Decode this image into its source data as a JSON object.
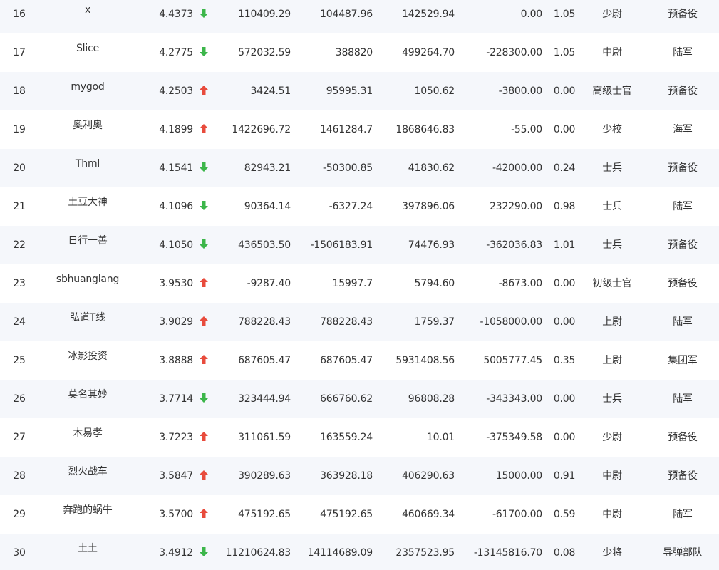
{
  "colors": {
    "up_arrow": "#e84b3c",
    "down_arrow": "#3cb64a",
    "text": "#333333",
    "row_stripe": "#f5f7fb"
  },
  "rows": [
    {
      "rank": "16",
      "name": "x",
      "score": "4.4373",
      "trend": "down",
      "v1": "110409.29",
      "v2": "104487.96",
      "v3": "142529.94",
      "v4": "0.00",
      "ratio": "1.05",
      "title": "少尉",
      "army": "预备役"
    },
    {
      "rank": "17",
      "name": "Slice",
      "score": "4.2775",
      "trend": "down",
      "v1": "572032.59",
      "v2": "388820",
      "v3": "499264.70",
      "v4": "-228300.00",
      "ratio": "1.05",
      "title": "中尉",
      "army": "陆军"
    },
    {
      "rank": "18",
      "name": "mygod",
      "score": "4.2503",
      "trend": "up",
      "v1": "3424.51",
      "v2": "95995.31",
      "v3": "1050.62",
      "v4": "-3800.00",
      "ratio": "0.00",
      "title": "高级士官",
      "army": "预备役"
    },
    {
      "rank": "19",
      "name": "奥利奥",
      "score": "4.1899",
      "trend": "up",
      "v1": "1422696.72",
      "v2": "1461284.7",
      "v3": "1868646.83",
      "v4": "-55.00",
      "ratio": "0.00",
      "title": "少校",
      "army": "海军"
    },
    {
      "rank": "20",
      "name": "Thml",
      "score": "4.1541",
      "trend": "down",
      "v1": "82943.21",
      "v2": "-50300.85",
      "v3": "41830.62",
      "v4": "-42000.00",
      "ratio": "0.24",
      "title": "士兵",
      "army": "预备役"
    },
    {
      "rank": "21",
      "name": "土豆大神",
      "score": "4.1096",
      "trend": "down",
      "v1": "90364.14",
      "v2": "-6327.24",
      "v3": "397896.06",
      "v4": "232290.00",
      "ratio": "0.98",
      "title": "士兵",
      "army": "陆军"
    },
    {
      "rank": "22",
      "name": "日行一善",
      "score": "4.1050",
      "trend": "down",
      "v1": "436503.50",
      "v2": "-1506183.91",
      "v3": "74476.93",
      "v4": "-362036.83",
      "ratio": "1.01",
      "title": "士兵",
      "army": "预备役"
    },
    {
      "rank": "23",
      "name": "sbhuanglang",
      "score": "3.9530",
      "trend": "up",
      "v1": "-9287.40",
      "v2": "15997.7",
      "v3": "5794.60",
      "v4": "-8673.00",
      "ratio": "0.00",
      "title": "初级士官",
      "army": "预备役"
    },
    {
      "rank": "24",
      "name": "弘道T线",
      "score": "3.9029",
      "trend": "up",
      "v1": "788228.43",
      "v2": "788228.43",
      "v3": "1759.37",
      "v4": "-1058000.00",
      "ratio": "0.00",
      "title": "上尉",
      "army": "陆军"
    },
    {
      "rank": "25",
      "name": "冰影投资",
      "score": "3.8888",
      "trend": "up",
      "v1": "687605.47",
      "v2": "687605.47",
      "v3": "5931408.56",
      "v4": "5005777.45",
      "ratio": "0.35",
      "title": "上尉",
      "army": "集团军"
    },
    {
      "rank": "26",
      "name": "莫名其妙",
      "score": "3.7714",
      "trend": "down",
      "v1": "323444.94",
      "v2": "666760.62",
      "v3": "96808.28",
      "v4": "-343343.00",
      "ratio": "0.00",
      "title": "士兵",
      "army": "陆军"
    },
    {
      "rank": "27",
      "name": "木易孝",
      "score": "3.7223",
      "trend": "up",
      "v1": "311061.59",
      "v2": "163559.24",
      "v3": "10.01",
      "v4": "-375349.58",
      "ratio": "0.00",
      "title": "少尉",
      "army": "预备役"
    },
    {
      "rank": "28",
      "name": "烈火战车",
      "score": "3.5847",
      "trend": "up",
      "v1": "390289.63",
      "v2": "363928.18",
      "v3": "406290.63",
      "v4": "15000.00",
      "ratio": "0.91",
      "title": "中尉",
      "army": "预备役"
    },
    {
      "rank": "29",
      "name": "奔跑的蜗牛",
      "score": "3.5700",
      "trend": "up",
      "v1": "475192.65",
      "v2": "475192.65",
      "v3": "460669.34",
      "v4": "-61700.00",
      "ratio": "0.59",
      "title": "中尉",
      "army": "陆军"
    },
    {
      "rank": "30",
      "name": "土土",
      "score": "3.4912",
      "trend": "down",
      "v1": "11210624.83",
      "v2": "14114689.09",
      "v3": "2357523.95",
      "v4": "-13145816.70",
      "ratio": "0.08",
      "title": "少将",
      "army": "导弹部队"
    }
  ]
}
